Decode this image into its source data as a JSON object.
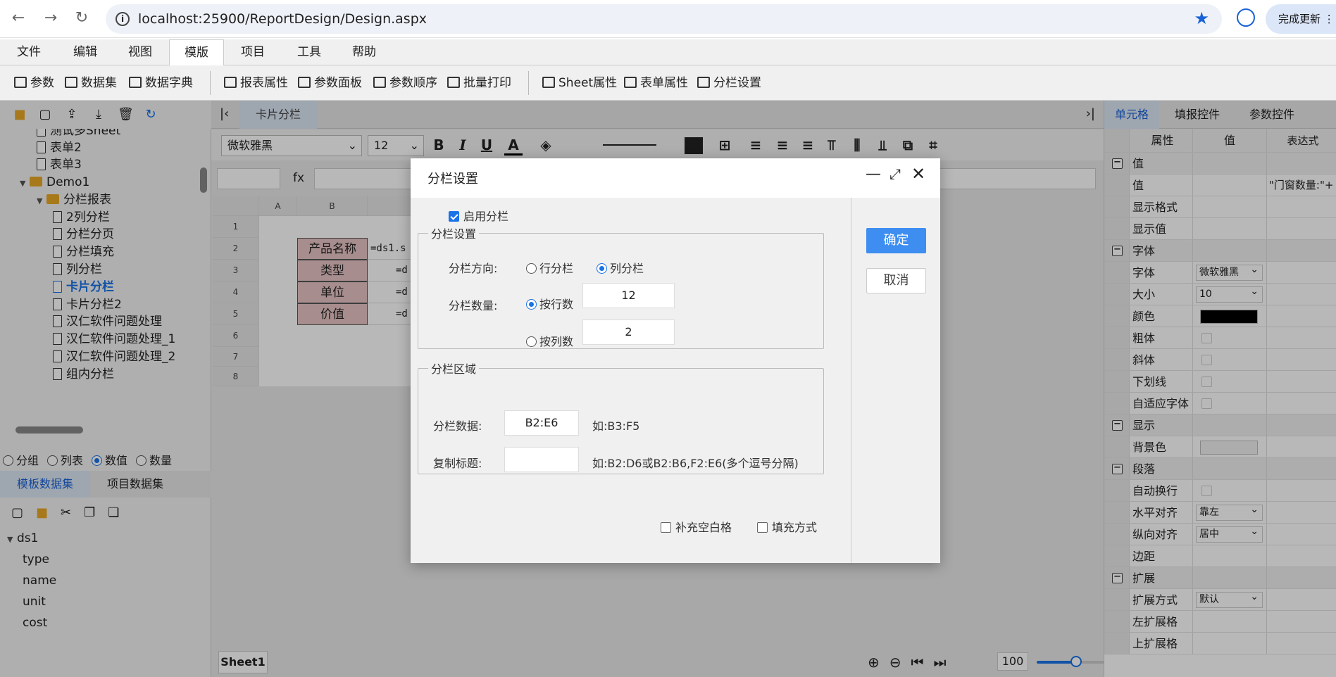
{
  "browser": {
    "url": "localhost:25900/ReportDesign/Design.aspx",
    "update_label": "完成更新"
  },
  "menubar": {
    "items": [
      "文件",
      "编辑",
      "视图",
      "模版",
      "项目",
      "工具",
      "帮助"
    ],
    "active": "模版"
  },
  "toolbar": {
    "items": [
      "参数",
      "数据集",
      "数据字典",
      "报表属性",
      "参数面板",
      "参数顺序",
      "批量打印",
      "Sheet属性",
      "表单属性",
      "分栏设置"
    ]
  },
  "tree": {
    "items": [
      "测试多Sheet",
      "表单2",
      "表单3",
      "Demo1",
      "分栏报表",
      "2列分栏",
      "分栏分页",
      "分栏填充",
      "列分栏",
      "卡片分栏",
      "卡片分栏2",
      "汉仁软件问题处理",
      "汉仁软件问题处理_1",
      "汉仁软件问题处理_2",
      "组内分栏"
    ],
    "selected": "卡片分栏"
  },
  "field_type": {
    "options": [
      "分组",
      "列表",
      "数值",
      "数量"
    ],
    "selected": "数值"
  },
  "dataset_tabs": [
    "模板数据集",
    "项目数据集"
  ],
  "dataset": {
    "name": "ds1",
    "fields": [
      "type",
      "name",
      "unit",
      "cost"
    ]
  },
  "center": {
    "tab_label": "卡片分栏",
    "font_name": "微软雅黑",
    "font_size": "12",
    "fx_label": "fx",
    "columns": [
      "A",
      "B"
    ],
    "rows": [
      "1",
      "2",
      "3",
      "4",
      "5",
      "6",
      "7",
      "8"
    ],
    "cells": {
      "b2": "产品名称",
      "c2": "=ds1.s",
      "b3": "类型",
      "c3": "=d",
      "b4": "单位",
      "c4": "=d",
      "b5": "价值",
      "c5": "=d"
    },
    "sheet_tab": "Sheet1",
    "zoom": "100"
  },
  "right": {
    "tabs": [
      "单元格",
      "填报控件",
      "参数控件"
    ],
    "headers": [
      "属性",
      "值",
      "表达式"
    ],
    "rows": [
      {
        "group": true,
        "name": "值"
      },
      {
        "name": "值",
        "expr": "\"门窗数量:\"+"
      },
      {
        "name": "显示格式"
      },
      {
        "name": "显示值"
      },
      {
        "group": true,
        "name": "字体"
      },
      {
        "name": "字体",
        "select": "微软雅黑"
      },
      {
        "name": "大小",
        "select": "10"
      },
      {
        "name": "颜色",
        "color": "#000000"
      },
      {
        "name": "粗体",
        "check": true
      },
      {
        "name": "斜体",
        "check": true
      },
      {
        "name": "下划线",
        "check": true
      },
      {
        "name": "自适应字体",
        "check": true
      },
      {
        "group": true,
        "name": "显示"
      },
      {
        "name": "背景色",
        "color": "#f0f0f0"
      },
      {
        "group": true,
        "name": "段落"
      },
      {
        "name": "自动换行",
        "check": true
      },
      {
        "name": "水平对齐",
        "select": "靠左"
      },
      {
        "name": "纵向对齐",
        "select": "居中"
      },
      {
        "name": "边距"
      },
      {
        "group": true,
        "name": "扩展"
      },
      {
        "name": "扩展方式",
        "select": "默认"
      },
      {
        "name": "左扩展格"
      },
      {
        "name": "上扩展格"
      }
    ]
  },
  "dialog": {
    "title": "分栏设置",
    "enable_label": "启用分栏",
    "section1": "分栏设置",
    "direction_label": "分栏方向:",
    "dir_row": "行分栏",
    "dir_col": "列分栏",
    "count_label": "分栏数量:",
    "by_rows": "按行数",
    "by_rows_value": "12",
    "by_cols": "按列数",
    "by_cols_value": "2",
    "section2": "分栏区域",
    "data_label": "分栏数据:",
    "data_value": "B2:E6",
    "data_hint": "如:B3:F5",
    "copy_label": "复制标题:",
    "copy_value": "",
    "copy_hint": "如:B2:D6或B2:B6,F2:E6(多个逗号分隔)",
    "fill_blank": "补充空白格",
    "fill_mode": "填充方式",
    "ok": "确定",
    "cancel": "取消"
  }
}
